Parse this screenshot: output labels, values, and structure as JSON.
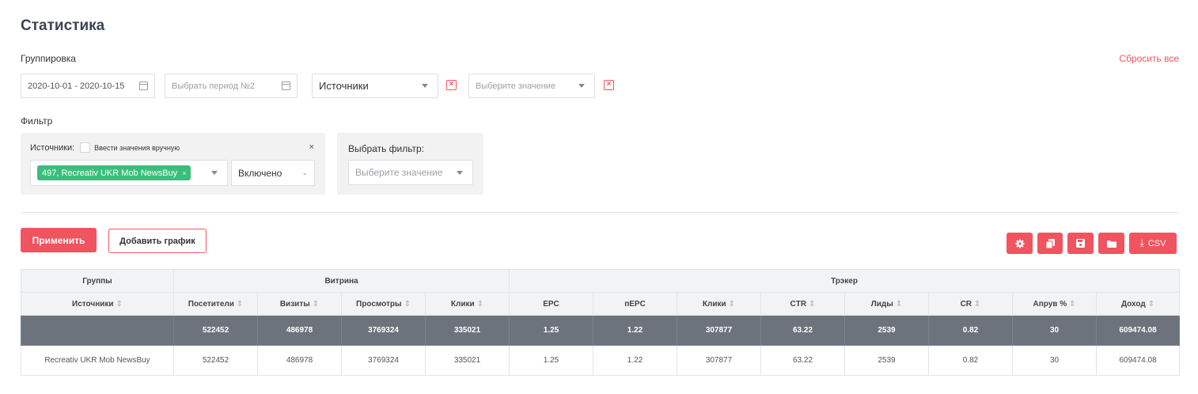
{
  "page_title": "Статистика",
  "grouping": {
    "label": "Группировка",
    "reset_label": "Сбросить все",
    "date_range": "2020-10-01 - 2020-10-15",
    "period2_placeholder": "Выбрать период №2",
    "group_select": "Источники",
    "value_placeholder": "Выберите значение"
  },
  "filter": {
    "label": "Фильтр",
    "source_label": "Источники:",
    "manual_label": "Ввести значения вручную",
    "close_label": "×",
    "tag_label": "497, Recreativ UKR Mob NewsBuy",
    "tag_remove": "×",
    "state_select": "Включено",
    "choose_filter_label": "Выбрать фильтр:",
    "choose_filter_placeholder": "Выберите значение"
  },
  "actions": {
    "apply_label": "Применить",
    "add_chart_label": "Добавить график",
    "csv_label": "CSV"
  },
  "table": {
    "groups": [
      "Группы",
      "Витрина",
      "Трэкер"
    ],
    "columns": [
      {
        "label": "Источники",
        "sortable": true
      },
      {
        "label": "Посетители",
        "sortable": true
      },
      {
        "label": "Визиты",
        "sortable": true
      },
      {
        "label": "Просмотры",
        "sortable": true
      },
      {
        "label": "Клики",
        "sortable": true
      },
      {
        "label": "EPC",
        "sortable": false
      },
      {
        "label": "пEPC",
        "sortable": false
      },
      {
        "label": "Клики",
        "sortable": true
      },
      {
        "label": "CTR",
        "sortable": true
      },
      {
        "label": "Лиды",
        "sortable": true
      },
      {
        "label": "CR",
        "sortable": true
      },
      {
        "label": "Апрув %",
        "sortable": true
      },
      {
        "label": "Доход",
        "sortable": true
      }
    ],
    "total": [
      "",
      "522452",
      "486978",
      "3769324",
      "335021",
      "1.25",
      "1.22",
      "307877",
      "63.22",
      "2539",
      "0.82",
      "30",
      "609474.08"
    ],
    "rows": [
      [
        "Recreativ UKR Mob NewsBuy",
        "522452",
        "486978",
        "3769324",
        "335021",
        "1.25",
        "1.22",
        "307877",
        "63.22",
        "2539",
        "0.82",
        "30",
        "609474.08"
      ]
    ]
  },
  "colors": {
    "accent": "#f0545f",
    "tag": "#3dbd7d",
    "total_row": "#6c737c"
  }
}
